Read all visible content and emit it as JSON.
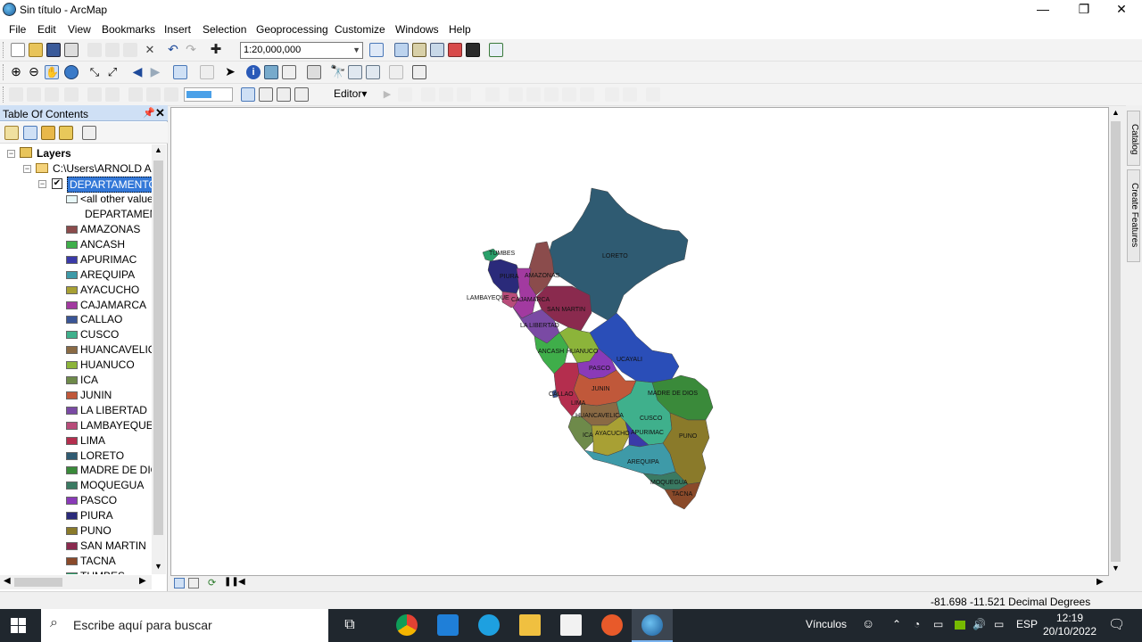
{
  "window": {
    "title": "Sin título - ArcMap"
  },
  "menu": [
    "File",
    "Edit",
    "View",
    "Bookmarks",
    "Insert",
    "Selection",
    "Geoprocessing",
    "Customize",
    "Windows",
    "Help"
  ],
  "toolbar": {
    "scale": "1:20,000,000",
    "editor_label": "Editor▾"
  },
  "toc": {
    "title": "Table Of Contents",
    "root": "Layers",
    "path": "C:\\Users\\ARNOLD AL\\",
    "layer": "DEPARTAMENTOS",
    "other_values": "<all other values>",
    "field": "DEPARTAMEN",
    "legend": [
      {
        "label": "AMAZONAS",
        "color": "#8b4c4c"
      },
      {
        "label": "ANCASH",
        "color": "#3fae4a"
      },
      {
        "label": "APURIMAC",
        "color": "#3a3aa8"
      },
      {
        "label": "AREQUIPA",
        "color": "#3e9aa8"
      },
      {
        "label": "AYACUCHO",
        "color": "#a8a034"
      },
      {
        "label": "CAJAMARCA",
        "color": "#a23aa0"
      },
      {
        "label": "CALLAO",
        "color": "#3a5596"
      },
      {
        "label": "CUSCO",
        "color": "#3fb08c"
      },
      {
        "label": "HUANCAVELICA",
        "color": "#8a6a44"
      },
      {
        "label": "HUANUCO",
        "color": "#8cb43a"
      },
      {
        "label": "ICA",
        "color": "#6e8a4a"
      },
      {
        "label": "JUNIN",
        "color": "#c0583a"
      },
      {
        "label": "LA LIBERTAD",
        "color": "#7a4aa4"
      },
      {
        "label": "LAMBAYEQUE",
        "color": "#b84c7a"
      },
      {
        "label": "LIMA",
        "color": "#b42e4e"
      },
      {
        "label": "LORETO",
        "color": "#2f5b72"
      },
      {
        "label": "MADRE DE DIOS",
        "color": "#3a8a3a"
      },
      {
        "label": "MOQUEGUA",
        "color": "#3a7a62"
      },
      {
        "label": "PASCO",
        "color": "#8a3ab8"
      },
      {
        "label": "PIURA",
        "color": "#2a2a7a"
      },
      {
        "label": "PUNO",
        "color": "#8a7a2a"
      },
      {
        "label": "SAN MARTIN",
        "color": "#8a2a4e"
      },
      {
        "label": "TACNA",
        "color": "#8a4a2a"
      },
      {
        "label": "TUMBES",
        "color": "#2aa06a"
      }
    ]
  },
  "map": {
    "labels": [
      "LORETO",
      "TUMBES",
      "PIURA",
      "AMAZONAS",
      "LAMBAYEQUE",
      "CAJAMARCA",
      "SAN MARTIN",
      "LA LIBERTAD",
      "ANCASH",
      "HUANUCO",
      "UCAYALI",
      "PASCO",
      "CALLAO",
      "JUNIN",
      "LIMA",
      "MADRE DE DIOS",
      "HUANCAVELICA",
      "CUSCO",
      "ICA",
      "AYACUCHO",
      "APURIMAC",
      "PUNO",
      "AREQUIPA",
      "MOQUEGUA",
      "TACNA"
    ]
  },
  "statusbar": {
    "coords": "-81.698  -11.521 Decimal Degrees"
  },
  "dock": {
    "catalog": "Catalog",
    "create_features": "Create Features"
  },
  "taskbar": {
    "search_placeholder": "Escribe aquí para buscar",
    "links": "Vínculos",
    "lang": "ESP",
    "time": "12:19",
    "date": "20/10/2022"
  }
}
